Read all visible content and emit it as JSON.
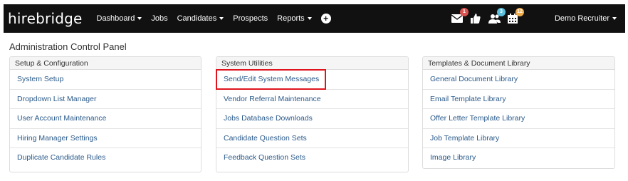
{
  "navbar": {
    "logo": "hirebridge",
    "items": [
      {
        "label": "Dashboard",
        "dropdown": true
      },
      {
        "label": "Jobs",
        "dropdown": false
      },
      {
        "label": "Candidates",
        "dropdown": true
      },
      {
        "label": "Prospects",
        "dropdown": false
      },
      {
        "label": "Reports",
        "dropdown": true
      }
    ],
    "icons": [
      {
        "name": "envelope-icon",
        "badge": "1",
        "badge_color": "#d9534f"
      },
      {
        "name": "thumbs-up-icon",
        "badge": "",
        "badge_color": ""
      },
      {
        "name": "users-icon",
        "badge": "3",
        "badge_color": "#5bc0de"
      },
      {
        "name": "calendar-icon",
        "badge": "12",
        "badge_color": "#f0ad4e"
      }
    ],
    "user": "Demo Recruiter"
  },
  "page": {
    "title": "Administration Control Panel"
  },
  "panels": [
    {
      "heading": "Setup & Configuration",
      "items": [
        "System Setup",
        "Dropdown List Manager",
        "User Account Maintenance",
        "Hiring Manager Settings",
        "Duplicate Candidate Rules"
      ]
    },
    {
      "heading": "System Utilities",
      "items": [
        "Send/Edit System Messages",
        "Vendor Referral Maintenance",
        "Jobs Database Downloads",
        "Candidate Question Sets",
        "Feedback Question Sets"
      ]
    },
    {
      "heading": "Templates & Document Library",
      "items": [
        "General Document Library",
        "Email Template Library",
        "Offer Letter Template Library",
        "Job Template Library",
        "Image Library"
      ]
    }
  ],
  "colors": {
    "navbar_bg": "#111111",
    "link": "#2a5a8a",
    "highlight": "#e0141e"
  }
}
